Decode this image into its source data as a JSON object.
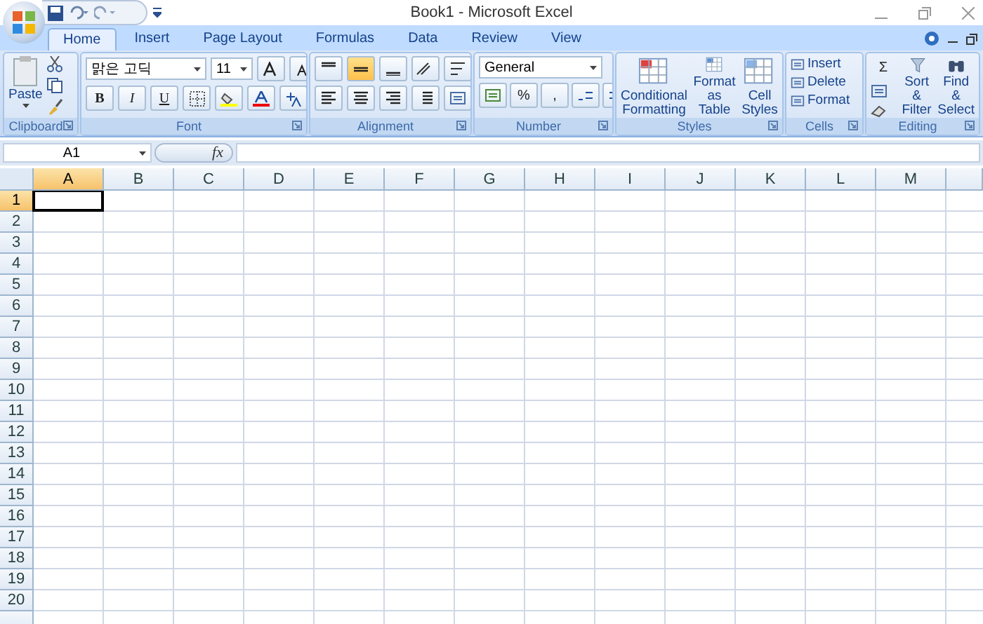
{
  "window": {
    "title": "Book1 - Microsoft Excel"
  },
  "tabs": [
    {
      "label": "Home",
      "selected": true
    },
    {
      "label": "Insert",
      "selected": false
    },
    {
      "label": "Page Layout",
      "selected": false
    },
    {
      "label": "Formulas",
      "selected": false
    },
    {
      "label": "Data",
      "selected": false
    },
    {
      "label": "Review",
      "selected": false
    },
    {
      "label": "View",
      "selected": false
    }
  ],
  "ribbon": {
    "clipboard": {
      "label": "Clipboard",
      "paste": "Paste"
    },
    "font": {
      "label": "Font",
      "face": "맑은 고딕",
      "size": "11",
      "bold": "B",
      "italic": "I",
      "underline": "U"
    },
    "alignment": {
      "label": "Alignment",
      "vertical": [
        {
          "selected": false
        },
        {
          "selected": true
        },
        {
          "selected": false
        }
      ]
    },
    "number": {
      "label": "Number",
      "format": "General",
      "percent": "%",
      "comma": ","
    },
    "styles": {
      "label": "Styles",
      "buttons": [
        "Conditional Formatting",
        "Format as Table",
        "Cell Styles"
      ]
    },
    "cells": {
      "label": "Cells",
      "buttons": [
        "Insert",
        "Delete",
        "Format"
      ]
    },
    "editing": {
      "label": "Editing",
      "sum": "Σ",
      "buttons": [
        "Sort & Filter",
        "Find & Select"
      ]
    }
  },
  "formula_bar": {
    "name_box": "A1",
    "fx": "fx"
  },
  "sheet": {
    "columns": [
      {
        "label": "A",
        "selected": true
      },
      {
        "label": "B",
        "selected": false
      },
      {
        "label": "C",
        "selected": false
      },
      {
        "label": "D",
        "selected": false
      },
      {
        "label": "E",
        "selected": false
      },
      {
        "label": "F",
        "selected": false
      },
      {
        "label": "G",
        "selected": false
      },
      {
        "label": "H",
        "selected": false
      },
      {
        "label": "I",
        "selected": false
      },
      {
        "label": "J",
        "selected": false
      },
      {
        "label": "K",
        "selected": false
      },
      {
        "label": "L",
        "selected": false
      },
      {
        "label": "M",
        "selected": false
      }
    ],
    "rows": [
      {
        "label": "1",
        "selected": true
      },
      {
        "label": "2",
        "selected": false
      },
      {
        "label": "3",
        "selected": false
      },
      {
        "label": "4",
        "selected": false
      },
      {
        "label": "5",
        "selected": false
      },
      {
        "label": "6",
        "selected": false
      },
      {
        "label": "7",
        "selected": false
      },
      {
        "label": "8",
        "selected": false
      },
      {
        "label": "9",
        "selected": false
      },
      {
        "label": "10",
        "selected": false
      },
      {
        "label": "11",
        "selected": false
      },
      {
        "label": "12",
        "selected": false
      },
      {
        "label": "13",
        "selected": false
      },
      {
        "label": "14",
        "selected": false
      },
      {
        "label": "15",
        "selected": false
      },
      {
        "label": "16",
        "selected": false
      },
      {
        "label": "17",
        "selected": false
      },
      {
        "label": "18",
        "selected": false
      },
      {
        "label": "19",
        "selected": false
      },
      {
        "label": "20",
        "selected": false
      }
    ]
  }
}
